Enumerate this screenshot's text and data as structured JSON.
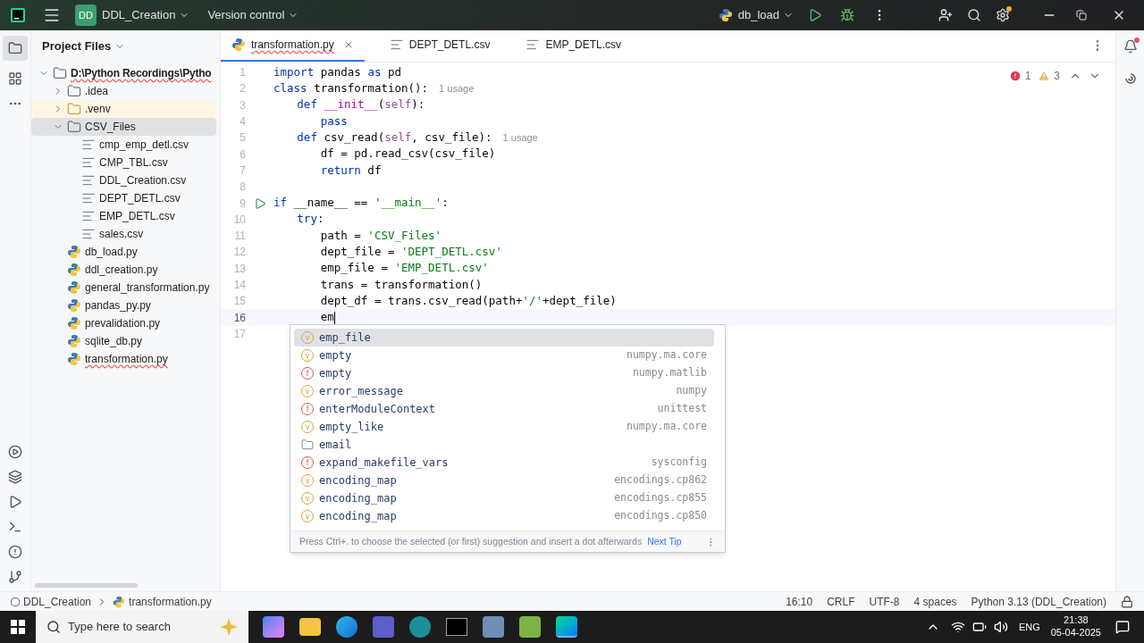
{
  "title_bar": {
    "project_badge": "DD",
    "project": "DDL_Creation",
    "vcs": "Version control",
    "run_config": "db_load",
    "settings_has_update": true
  },
  "project_panel": {
    "title": "Project Files",
    "tree": [
      {
        "label": "D:\\Python Recordings\\Pytho",
        "kind": "folder",
        "expanded": true,
        "selected": false,
        "excluded": false,
        "error": true,
        "children": [
          {
            "label": ".idea",
            "kind": "folder",
            "expanded": false,
            "selected": false,
            "excluded": false,
            "error": false
          },
          {
            "label": ".venv",
            "kind": "folder",
            "expanded": false,
            "selected": false,
            "excluded": true,
            "error": false
          },
          {
            "label": "CSV_Files",
            "kind": "folder",
            "expanded": true,
            "selected": true,
            "excluded": false,
            "error": false,
            "children": [
              {
                "label": "cmp_emp_detl.csv",
                "kind": "text",
                "selected": false,
                "excluded": false,
                "error": false
              },
              {
                "label": "CMP_TBL.csv",
                "kind": "text",
                "selected": false,
                "excluded": false,
                "error": false
              },
              {
                "label": "DDL_Creation.csv",
                "kind": "text",
                "selected": false,
                "excluded": false,
                "error": false
              },
              {
                "label": "DEPT_DETL.csv",
                "kind": "text",
                "selected": false,
                "excluded": false,
                "error": false
              },
              {
                "label": "EMP_DETL.csv",
                "kind": "text",
                "selected": false,
                "excluded": false,
                "error": false
              },
              {
                "label": "sales.csv",
                "kind": "text",
                "selected": false,
                "excluded": false,
                "error": false
              }
            ]
          },
          {
            "label": "db_load.py",
            "kind": "python",
            "selected": false,
            "excluded": false,
            "error": false
          },
          {
            "label": "ddl_creation.py",
            "kind": "python",
            "selected": false,
            "excluded": false,
            "error": false
          },
          {
            "label": "general_transformation.py",
            "kind": "python",
            "selected": false,
            "excluded": false,
            "error": false
          },
          {
            "label": "pandas_py.py",
            "kind": "python",
            "selected": false,
            "excluded": false,
            "error": false
          },
          {
            "label": "prevalidation.py",
            "kind": "python",
            "selected": false,
            "excluded": false,
            "error": false
          },
          {
            "label": "sqlite_db.py",
            "kind": "python",
            "selected": false,
            "excluded": false,
            "error": false
          },
          {
            "label": "transformation.py",
            "kind": "python",
            "selected": false,
            "excluded": false,
            "error": true
          }
        ]
      }
    ]
  },
  "tabs": [
    {
      "label": "transformation.py",
      "kind": "python",
      "selected": true,
      "error": true,
      "closable": true
    },
    {
      "label": "DEPT_DETL.csv",
      "kind": "text",
      "selected": false,
      "error": false,
      "closable": false
    },
    {
      "label": "EMP_DETL.csv",
      "kind": "text",
      "selected": false,
      "error": false,
      "closable": false
    }
  ],
  "inspections": {
    "errors": "1",
    "warnings": "3"
  },
  "code": [
    {
      "number": "1",
      "run": false,
      "current": false,
      "tokens": [
        {
          "kind": "keyword",
          "text": "import"
        },
        {
          "kind": "plain",
          "text": " pandas "
        },
        {
          "kind": "keyword",
          "text": "as"
        },
        {
          "kind": "plain",
          "text": " pd"
        }
      ]
    },
    {
      "number": "2",
      "run": false,
      "current": false,
      "tokens": [
        {
          "kind": "keyword",
          "text": "class"
        },
        {
          "kind": "plain",
          "text": " transformation():"
        },
        {
          "kind": "hint",
          "text": "1 usage"
        }
      ],
      "children": [
        {
          "number": "3",
          "run": false,
          "current": false,
          "tokens": [
            {
              "kind": "keyword",
              "text": "def"
            },
            {
              "kind": "magic",
              "text": " __init__"
            },
            {
              "kind": "plain",
              "text": "("
            },
            {
              "kind": "self",
              "text": "self"
            },
            {
              "kind": "plain",
              "text": "):"
            }
          ],
          "children": [
            {
              "number": "4",
              "run": false,
              "current": false,
              "tokens": [
                {
                  "kind": "keyword",
                  "text": "pass"
                }
              ]
            }
          ]
        },
        {
          "number": "5",
          "run": false,
          "current": false,
          "tokens": [
            {
              "kind": "keyword",
              "text": "def"
            },
            {
              "kind": "plain",
              "text": " csv_read("
            },
            {
              "kind": "self",
              "text": "self"
            },
            {
              "kind": "plain",
              "text": ", csv_file):"
            },
            {
              "kind": "hint",
              "text": "1 usage"
            }
          ],
          "children": [
            {
              "number": "6",
              "run": false,
              "current": false,
              "tokens": [
                {
                  "kind": "plain",
                  "text": "df = pd.read_csv(csv_file)"
                }
              ]
            },
            {
              "number": "7",
              "run": false,
              "current": false,
              "tokens": [
                {
                  "kind": "keyword",
                  "text": "return"
                },
                {
                  "kind": "plain",
                  "text": " df"
                }
              ]
            }
          ]
        }
      ]
    },
    {
      "number": "8",
      "run": false,
      "current": false
    },
    {
      "number": "9",
      "run": true,
      "current": false,
      "tokens": [
        {
          "kind": "keyword",
          "text": "if"
        },
        {
          "kind": "plain",
          "text": " __name__ == "
        },
        {
          "kind": "string",
          "text": "'__main__'"
        },
        {
          "kind": "plain",
          "text": ":"
        }
      ],
      "children": [
        {
          "number": "10",
          "run": false,
          "current": false,
          "tokens": [
            {
              "kind": "keyword",
              "text": "try"
            },
            {
              "kind": "plain",
              "text": ":"
            }
          ],
          "children": [
            {
              "number": "11",
              "run": false,
              "current": false,
              "tokens": [
                {
                  "kind": "plain",
                  "text": "path = "
                },
                {
                  "kind": "string",
                  "text": "'CSV_Files'"
                }
              ]
            },
            {
              "number": "12",
              "run": false,
              "current": false,
              "tokens": [
                {
                  "kind": "plain",
                  "text": "dept_file = "
                },
                {
                  "kind": "string",
                  "text": "'DEPT_DETL.csv'"
                }
              ]
            },
            {
              "number": "13",
              "run": false,
              "current": false,
              "tokens": [
                {
                  "kind": "plain",
                  "text": "emp_file = "
                },
                {
                  "kind": "string",
                  "text": "'EMP_DETL.csv'"
                }
              ]
            },
            {
              "number": "14",
              "run": false,
              "current": false,
              "tokens": [
                {
                  "kind": "plain",
                  "text": "trans = transformation()"
                }
              ]
            },
            {
              "number": "15",
              "run": false,
              "current": false,
              "tokens": [
                {
                  "kind": "plain",
                  "text": "dept_df = trans.csv_read(path+"
                },
                {
                  "kind": "string",
                  "text": "'/'"
                },
                {
                  "kind": "plain",
                  "text": "+dept_file)"
                }
              ]
            },
            {
              "number": "16",
              "run": false,
              "current": true,
              "tokens": [
                {
                  "kind": "plain",
                  "text": "em"
                }
              ]
            }
          ]
        }
      ]
    },
    {
      "number": "17",
      "run": false,
      "current": false
    }
  ],
  "completion": {
    "items": [
      {
        "kind": "variable",
        "icon": "v",
        "label": "emp_file",
        "selected": true
      },
      {
        "kind": "variable",
        "icon": "v",
        "label": "empty",
        "source": "numpy.ma.core",
        "selected": false
      },
      {
        "kind": "function",
        "icon": "f",
        "label": "empty",
        "source": "numpy.matlib",
        "selected": false
      },
      {
        "kind": "variable",
        "icon": "v",
        "label": "error_message",
        "source": "numpy",
        "selected": false
      },
      {
        "kind": "function",
        "icon": "f",
        "label": "enterModuleContext",
        "source": "unittest",
        "selected": false
      },
      {
        "kind": "variable",
        "icon": "v",
        "label": "empty_like",
        "source": "numpy.ma.core",
        "selected": false
      },
      {
        "kind": "module",
        "label": "email",
        "selected": false
      },
      {
        "kind": "function",
        "icon": "f",
        "label": "expand_makefile_vars",
        "source": "sysconfig",
        "selected": false
      },
      {
        "kind": "variable",
        "icon": "v",
        "label": "encoding_map",
        "source": "encodings.cp862",
        "selected": false
      },
      {
        "kind": "variable",
        "icon": "v",
        "label": "encoding_map",
        "source": "encodings.cp855",
        "selected": false
      },
      {
        "kind": "variable",
        "icon": "v",
        "label": "encoding_map",
        "source": "encodings.cp850",
        "selected": false
      }
    ],
    "tip": "Press Ctrl+. to choose the selected (or first) suggestion and insert a dot afterwards",
    "tip_link": "Next Tip"
  },
  "status_bar": {
    "breadcrumb": [
      "DDL_Creation",
      "transformation.py"
    ],
    "position": "16:10",
    "line_endings": "CRLF",
    "encoding": "UTF-8",
    "indent": "4 spaces",
    "interpreter": "Python 3.13 (DDL_Creation)"
  },
  "taskbar": {
    "search_placeholder": "Type here to search",
    "time": "21:38",
    "date": "05-04-2025",
    "language": "ENG"
  }
}
